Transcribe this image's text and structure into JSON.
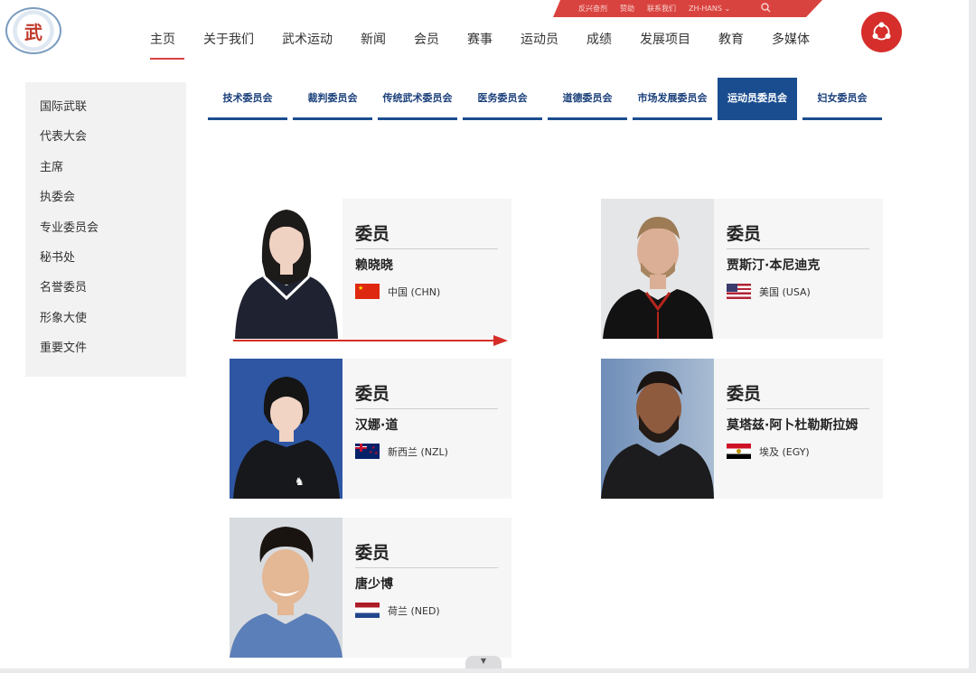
{
  "utility_links": [
    "反兴奋剂",
    "赞助",
    "联系我们",
    "ZH-HANS"
  ],
  "logo_text": "武",
  "nav": [
    "主页",
    "关于我们",
    "武术运动",
    "新闻",
    "会员",
    "赛事",
    "运动员",
    "成绩",
    "发展项目",
    "教育",
    "多媒体"
  ],
  "sidebar": [
    "国际武联",
    "代表大会",
    "主席",
    "执委会",
    "专业委员会",
    "秘书处",
    "名誉委员",
    "形象大使",
    "重要文件"
  ],
  "tabs": [
    "技术委员会",
    "裁判委员会",
    "传统武术委员会",
    "医务委员会",
    "道德委员会",
    "市场发展委员会",
    "运动员委员会",
    "妇女委员会"
  ],
  "active_tab_index": 6,
  "members": [
    {
      "role": "委员",
      "name": "赖晓晓",
      "country": "中国 (CHN)",
      "flag": "chn"
    },
    {
      "role": "委员",
      "name": "贾斯汀·本尼迪克",
      "country": "美国 (USA)",
      "flag": "usa"
    },
    {
      "role": "委员",
      "name": "汉娜·道",
      "country": "新西兰 (NZL)",
      "flag": "nzl"
    },
    {
      "role": "委员",
      "name": "莫塔兹·阿卜杜勒斯拉姆",
      "country": "埃及 (EGY)",
      "flag": "egy"
    },
    {
      "role": "委员",
      "name": "唐少博",
      "country": "荷兰 (NED)",
      "flag": "ned"
    }
  ],
  "colors": {
    "accent": "#d9433f",
    "tab_blue": "#1a4d8f"
  },
  "icons": {
    "search": "search-icon",
    "share": "share-icon",
    "scroll": "chevron-down-icon"
  }
}
